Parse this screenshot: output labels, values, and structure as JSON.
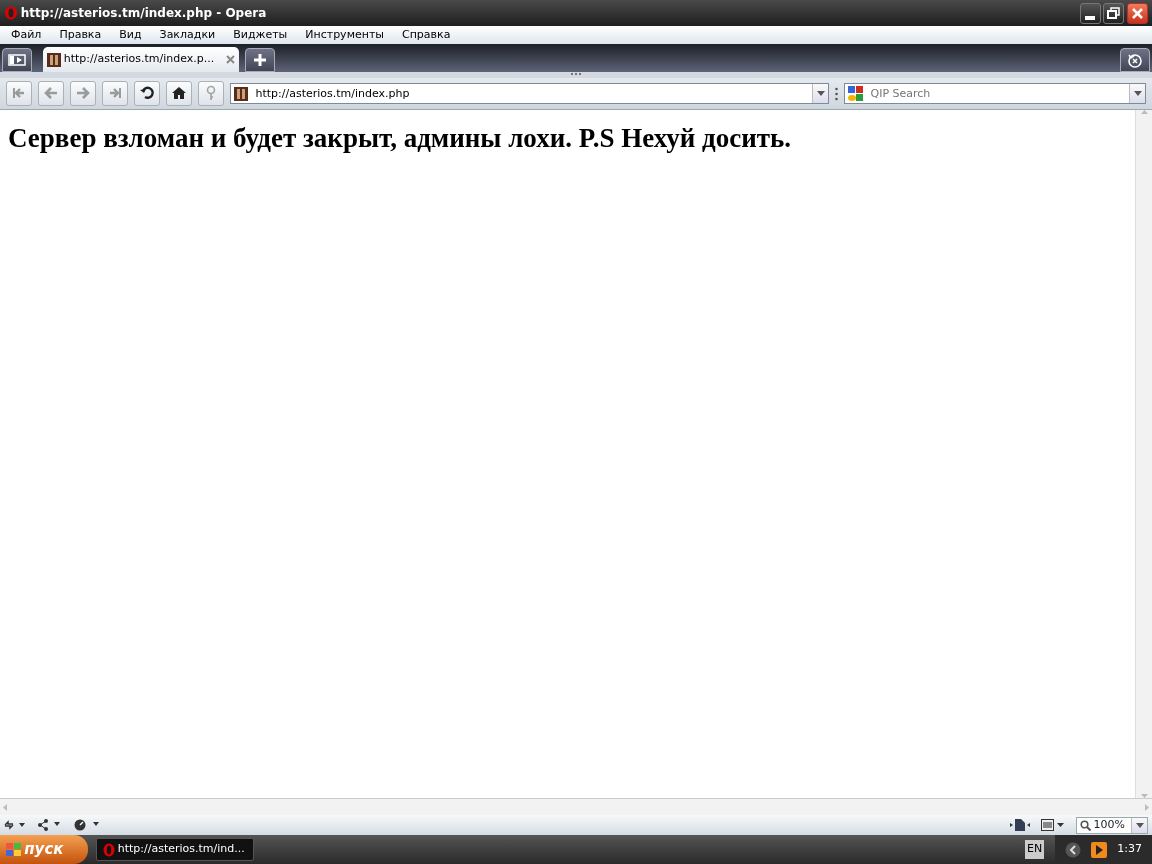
{
  "window": {
    "title": "http://asterios.tm/index.php - Opera"
  },
  "menu": [
    "Файл",
    "Правка",
    "Вид",
    "Закладки",
    "Виджеты",
    "Инструменты",
    "Справка"
  ],
  "tabs": [
    {
      "label": "http://asterios.tm/index.p...",
      "selected": true
    }
  ],
  "toolbar": [
    {
      "kind": "rewind",
      "disabled": true
    },
    {
      "kind": "back",
      "disabled": true
    },
    {
      "kind": "forward",
      "disabled": true
    },
    {
      "kind": "fastforward",
      "disabled": true
    },
    {
      "kind": "reload",
      "disabled": false
    },
    {
      "kind": "home",
      "disabled": false
    },
    {
      "kind": "wand",
      "disabled": true
    }
  ],
  "address": {
    "value": "http://asterios.tm/index.php"
  },
  "search": {
    "placeholder": "QIP Search"
  },
  "page": {
    "heading": "Сервер взломан и будет закрыт, админы лохи. P.S Нехуй досить."
  },
  "status_bar": {
    "zoom": "100%"
  },
  "taskbar": {
    "start": "пуск",
    "tasks": [
      {
        "label": "http://asterios.tm/ind...",
        "selected": true
      }
    ],
    "language": "EN",
    "clock": "1:37"
  }
}
